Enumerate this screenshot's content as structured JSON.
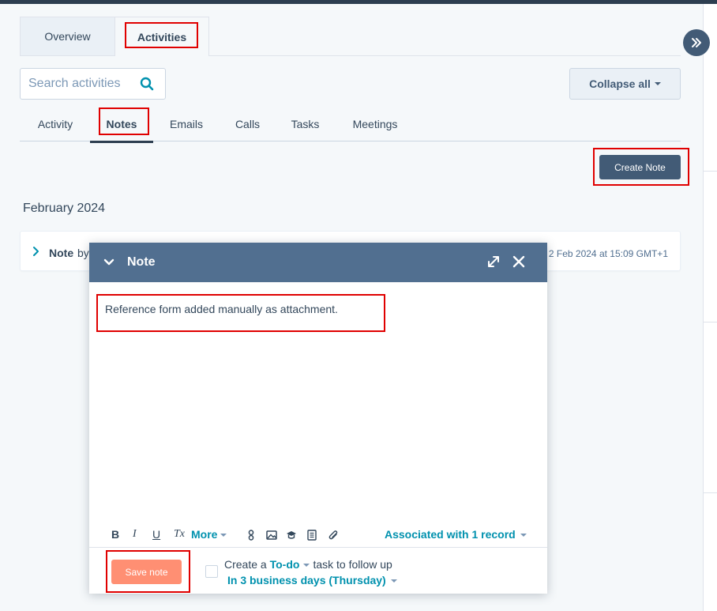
{
  "tabs": {
    "overview": "Overview",
    "activities": "Activities"
  },
  "search": {
    "placeholder": "Search activities"
  },
  "collapse_all": "Collapse all",
  "subtabs": [
    "Activity",
    "Notes",
    "Emails",
    "Calls",
    "Tasks",
    "Meetings"
  ],
  "create_note": "Create Note",
  "month": "February 2024",
  "note_card": {
    "label": "Note",
    "by": "by",
    "date": "2 Feb 2024 at 15:09 GMT+1"
  },
  "modal": {
    "title": "Note",
    "body": "Reference form added manually as attachment.",
    "toolbar": {
      "bold": "B",
      "italic": "I",
      "underline": "U",
      "clear": "Tx",
      "more": "More",
      "associated": "Associated with 1 record"
    },
    "save": "Save note",
    "todo": {
      "prefix": "Create a ",
      "type": "To-do",
      "suffix": "task to follow up",
      "due": "In 3 business days (Thursday)"
    }
  },
  "colors": {
    "header_dark": "#2d3e50",
    "modal_header": "#516f90",
    "link": "#0091ae",
    "save_button": "#ff8f73",
    "highlight": "#e00000"
  }
}
